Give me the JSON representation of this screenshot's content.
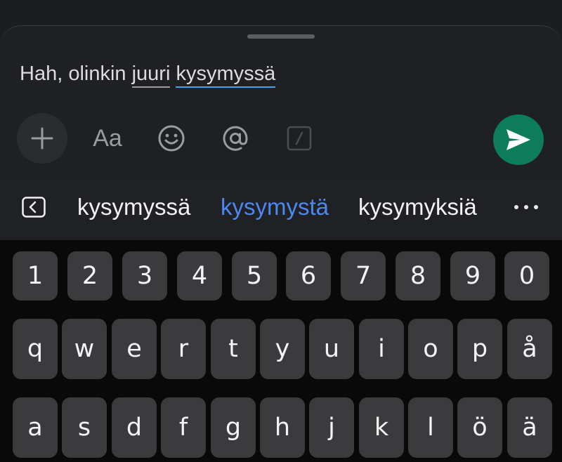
{
  "composer": {
    "words": [
      "Hah,",
      "olinkin",
      "juuri",
      "kysymyssä"
    ],
    "toolbar": {
      "plus_icon": "plus-icon",
      "format_label": "Aa",
      "emoji_icon": "smiley-icon",
      "mention_icon": "at-icon",
      "slash_icon": "slash-command-icon",
      "send_icon": "send-arrow-icon",
      "send_color": "#0d7d59"
    }
  },
  "suggestions": {
    "collapse_icon": "chevron-left-icon",
    "items": [
      {
        "text": "kysymyssä",
        "highlighted": false
      },
      {
        "text": "kysymystä",
        "highlighted": true
      },
      {
        "text": "kysymyksiä",
        "highlighted": false
      }
    ],
    "more_icon": "more-dots-icon",
    "highlight_color": "#4d88f0"
  },
  "keyboard": {
    "rows": [
      [
        "1",
        "2",
        "3",
        "4",
        "5",
        "6",
        "7",
        "8",
        "9",
        "0"
      ],
      [
        "q",
        "w",
        "e",
        "r",
        "t",
        "y",
        "u",
        "i",
        "o",
        "p",
        "å"
      ],
      [
        "a",
        "s",
        "d",
        "f",
        "g",
        "h",
        "j",
        "k",
        "l",
        "ö",
        "ä"
      ]
    ]
  }
}
